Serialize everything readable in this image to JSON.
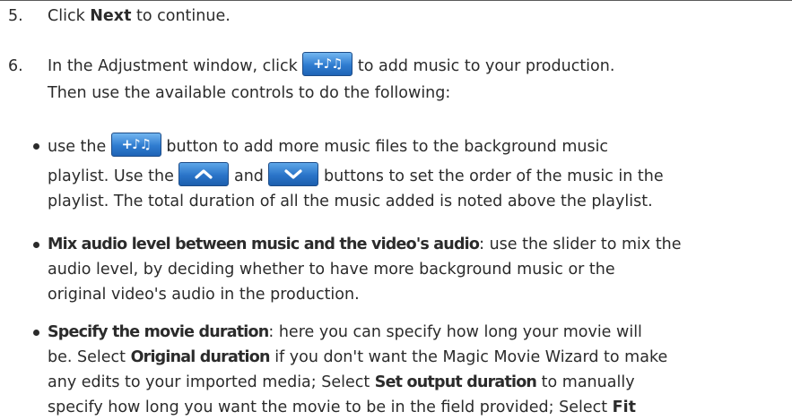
{
  "step5": {
    "number": "5.",
    "pre": "Click ",
    "bold": "Next",
    "post": " to continue."
  },
  "step6": {
    "number": "6.",
    "line1_pre": "In the Adjustment window, click ",
    "line1_post": " to add music to your production.",
    "line2": "Then use the available controls to do the following:"
  },
  "icons": {
    "add_music": "add-music-icon",
    "up": "chevron-up-icon",
    "down": "chevron-down-icon",
    "add_music_glyph": "+♪♫",
    "accent": "#2f7cd0"
  },
  "bullet1": {
    "line1_pre": "use the ",
    "line1_post": " button to add more music files to the background music",
    "line2_pre": "playlist. Use the ",
    "line2_mid": " and ",
    "line2_post": " buttons to set the order of the music in the",
    "line3": "playlist. The total duration of all the music added is noted above the playlist."
  },
  "bullet2": {
    "bold": "Mix audio level between music and the video's audio",
    "line1_post": ": use the slider to mix the",
    "line2": "audio level, by deciding whether to have more background music or the",
    "line3": "original video's audio in the production."
  },
  "bullet3": {
    "bold": "Specify the movie duration",
    "line1_post": ": here you can specify how long your movie will",
    "line2_pre": "be. Select ",
    "line2_bold": "Original duration",
    "line2_post": " if you don't want the Magic Movie Wizard to make",
    "line3_pre": "any edits to your imported media; Select ",
    "line3_bold": "Set output duration",
    "line3_post": " to manually",
    "line4_pre": "specify how long you want the movie to be in the field provided; Select ",
    "line4_bold": "Fit"
  }
}
